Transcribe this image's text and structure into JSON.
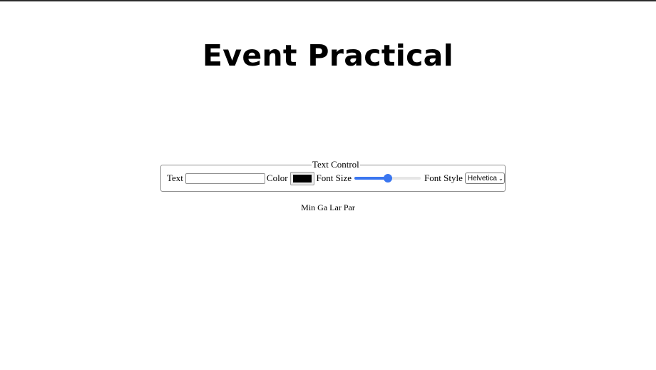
{
  "page": {
    "title": "Event Practical"
  },
  "controls": {
    "legend": "Text Control",
    "text_label": "Text",
    "text_value": "",
    "color_label": "Color",
    "color_value": "#000000",
    "font_size_label": "Font Size",
    "font_size_level": 0.5,
    "font_style_label": "Font Style",
    "font_style_value": "Helvetica"
  },
  "output": {
    "text": "Min Ga Lar Par"
  },
  "colors": {
    "slider_accent": "#3a76f0"
  }
}
